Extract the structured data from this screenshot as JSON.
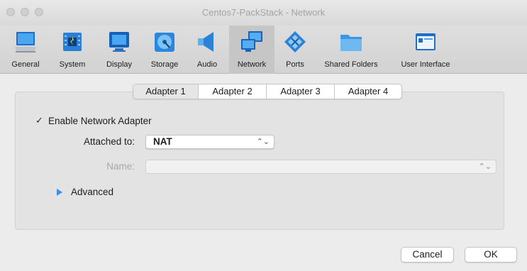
{
  "window": {
    "title": "Centos7-PackStack - Network"
  },
  "toolbar": {
    "items": [
      {
        "label": "General",
        "icon": "general-icon"
      },
      {
        "label": "System",
        "icon": "system-icon"
      },
      {
        "label": "Display",
        "icon": "display-icon"
      },
      {
        "label": "Storage",
        "icon": "storage-icon"
      },
      {
        "label": "Audio",
        "icon": "audio-icon"
      },
      {
        "label": "Network",
        "icon": "network-icon",
        "active": true
      },
      {
        "label": "Ports",
        "icon": "ports-icon"
      },
      {
        "label": "Shared Folders",
        "icon": "shared-folders-icon"
      },
      {
        "label": "User Interface",
        "icon": "user-interface-icon"
      }
    ]
  },
  "tabs": [
    {
      "label": "Adapter 1",
      "selected": true
    },
    {
      "label": "Adapter 2"
    },
    {
      "label": "Adapter 3"
    },
    {
      "label": "Adapter 4"
    }
  ],
  "adapter": {
    "enable_label": "Enable Network Adapter",
    "enable_checked": true,
    "checkmark": "✓",
    "attached_label": "Attached to:",
    "attached_value": "NAT",
    "name_label": "Name:",
    "name_value": "",
    "advanced_label": "Advanced"
  },
  "buttons": {
    "cancel": "Cancel",
    "ok": "OK"
  },
  "colors": {
    "accent": "#3d8ee6",
    "window_bg": "#ececec",
    "panel_bg": "#e3e3e3"
  }
}
